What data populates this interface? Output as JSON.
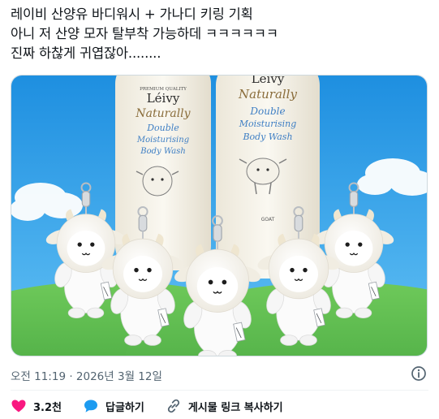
{
  "tweet": {
    "text": "레이비 산양유 바디워시 + 가나디 키링 기획\n아니 저 산양 모자 탈부착 가능하데 ㅋㅋㅋㅋㅋㅋ\n진짜 하찮게 귀엽잖아........",
    "timestamp": "오전 11:19 · 2026년 3월 12일"
  },
  "media": {
    "bottle_left": {
      "brand_top": "PREMIUM QUALITY",
      "brand": "Léivy",
      "line1": "Naturally",
      "line2": "Double",
      "line3": "Moisturising",
      "line4": "Body Wash"
    },
    "bottle_right": {
      "brand": "Léivy",
      "line1": "Naturally",
      "line2": "Double",
      "line3": "Moisturising",
      "line4": "Body Wash",
      "bottom": "GOAT"
    },
    "tag_text": "Léivy"
  },
  "actions": {
    "like_count": "3.2천",
    "reply_label": "답글하기",
    "share_label": "게시물 링크 복사하기"
  },
  "colors": {
    "like": "#f91880",
    "reply": "#1d9bf0",
    "muted": "#536471"
  }
}
